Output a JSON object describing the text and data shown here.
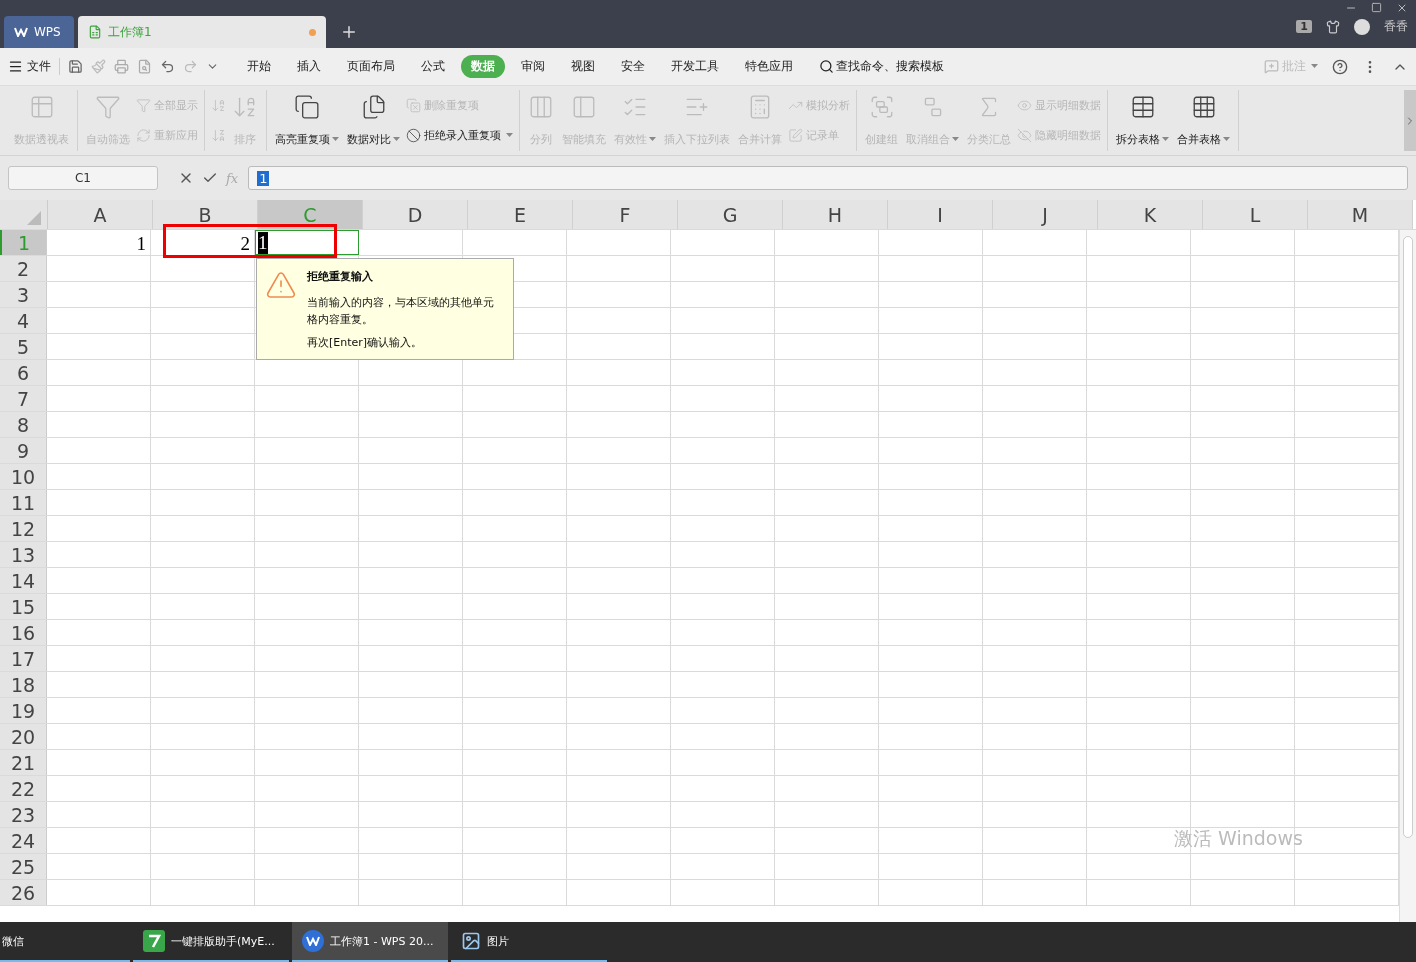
{
  "title_bar": {
    "tabs": [
      {
        "label": "WPS",
        "kind": "home",
        "selected": false
      },
      {
        "label": "工作簿1",
        "kind": "sheet",
        "selected": true,
        "unsaved": true
      }
    ],
    "badge": "1",
    "user": "香香"
  },
  "menu": {
    "file": "文件",
    "tabs": [
      {
        "label": "开始",
        "selected": false
      },
      {
        "label": "插入",
        "selected": false
      },
      {
        "label": "页面布局",
        "selected": false
      },
      {
        "label": "公式",
        "selected": false
      },
      {
        "label": "数据",
        "selected": true
      },
      {
        "label": "审阅",
        "selected": false
      },
      {
        "label": "视图",
        "selected": false
      },
      {
        "label": "安全",
        "selected": false
      },
      {
        "label": "开发工具",
        "selected": false
      },
      {
        "label": "特色应用",
        "selected": false
      }
    ],
    "search": "查找命令、搜索模板",
    "comment": {
      "label": "批注",
      "disabled": true
    }
  },
  "ribbon": {
    "groups": [
      {
        "items": [
          {
            "kind": "large",
            "label": "数据透视表",
            "disabled": true
          }
        ]
      },
      {
        "items": [
          {
            "kind": "large",
            "label": "自动筛选",
            "disabled": true
          },
          {
            "kind": "stack",
            "items": [
              {
                "label": "全部显示",
                "disabled": true
              },
              {
                "label": "重新应用",
                "disabled": true
              }
            ]
          }
        ]
      },
      {
        "items": [
          {
            "kind": "stack",
            "items": [
              {
                "disabled": true
              },
              {
                "disabled": true
              }
            ]
          },
          {
            "kind": "large",
            "label": "排序",
            "disabled": true
          }
        ]
      },
      {
        "items": [
          {
            "kind": "large",
            "label": "高亮重复项",
            "disabled": false,
            "dropdown": true
          },
          {
            "kind": "large",
            "label": "数据对比",
            "disabled": false,
            "dropdown": true
          },
          {
            "kind": "stack",
            "items": [
              {
                "label": "删除重复项",
                "disabled": true
              },
              {
                "label": "拒绝录入重复项",
                "disabled": false,
                "dropdown": true
              }
            ]
          }
        ]
      },
      {
        "items": [
          {
            "kind": "large",
            "label": "分列",
            "disabled": true
          },
          {
            "kind": "large",
            "label": "智能填充",
            "disabled": true
          },
          {
            "kind": "large",
            "label": "有效性",
            "disabled": true,
            "dropdown": true
          },
          {
            "kind": "large",
            "label": "插入下拉列表",
            "disabled": true
          },
          {
            "kind": "large",
            "label": "合并计算",
            "disabled": true
          },
          {
            "kind": "stack",
            "items": [
              {
                "label": "模拟分析",
                "disabled": true
              },
              {
                "label": "记录单",
                "disabled": true
              }
            ]
          }
        ]
      },
      {
        "items": [
          {
            "kind": "large",
            "label": "创建组",
            "disabled": true
          },
          {
            "kind": "large",
            "label": "取消组合",
            "disabled": true,
            "dropdown": true
          },
          {
            "kind": "large",
            "label": "分类汇总",
            "disabled": true
          },
          {
            "kind": "stack",
            "items": [
              {
                "label": "显示明细数据",
                "disabled": true
              },
              {
                "label": "隐藏明细数据",
                "disabled": true
              }
            ]
          }
        ]
      },
      {
        "items": [
          {
            "kind": "large",
            "label": "拆分表格",
            "disabled": false,
            "dropdown": true
          },
          {
            "kind": "large",
            "label": "合并表格",
            "disabled": false,
            "dropdown": true
          }
        ]
      }
    ]
  },
  "formula_bar": {
    "cell": "C1",
    "fx_label": "fx",
    "value": "1"
  },
  "sheet": {
    "columns": [
      {
        "label": "A",
        "selected": false
      },
      {
        "label": "B",
        "selected": false
      },
      {
        "label": "C",
        "selected": true
      },
      {
        "label": "D",
        "selected": false
      },
      {
        "label": "E",
        "selected": false
      },
      {
        "label": "F",
        "selected": false
      },
      {
        "label": "G",
        "selected": false
      },
      {
        "label": "H",
        "selected": false
      },
      {
        "label": "I",
        "selected": false
      },
      {
        "label": "J",
        "selected": false
      },
      {
        "label": "K",
        "selected": false
      },
      {
        "label": "L",
        "selected": false
      },
      {
        "label": "M",
        "selected": false
      }
    ],
    "rows": [
      {
        "label": "1",
        "selected": true,
        "cells": [
          {
            "value": "1",
            "editing": false
          },
          {
            "value": "2",
            "editing": false
          },
          {
            "value": "1",
            "editing": true
          }
        ]
      },
      {
        "label": "2",
        "selected": false
      },
      {
        "label": "3",
        "selected": false
      },
      {
        "label": "4",
        "selected": false
      },
      {
        "label": "5",
        "selected": false
      },
      {
        "label": "6",
        "selected": false
      },
      {
        "label": "7",
        "selected": false
      },
      {
        "label": "8",
        "selected": false
      },
      {
        "label": "9",
        "selected": false
      },
      {
        "label": "10",
        "selected": false
      },
      {
        "label": "11",
        "selected": false
      },
      {
        "label": "12",
        "selected": false
      },
      {
        "label": "13",
        "selected": false
      },
      {
        "label": "14",
        "selected": false
      },
      {
        "label": "15",
        "selected": false
      },
      {
        "label": "16",
        "selected": false
      },
      {
        "label": "17",
        "selected": false
      },
      {
        "label": "18",
        "selected": false
      },
      {
        "label": "19",
        "selected": false
      },
      {
        "label": "20",
        "selected": false
      },
      {
        "label": "21",
        "selected": false
      },
      {
        "label": "22",
        "selected": false
      },
      {
        "label": "23",
        "selected": false
      },
      {
        "label": "24",
        "selected": false
      },
      {
        "label": "25",
        "selected": false
      },
      {
        "label": "26",
        "selected": false
      }
    ]
  },
  "tooltip": {
    "title": "拒绝重复输入",
    "paragraphs": [
      "当前输入的内容，与本区域的其他单元格内容重复。",
      "再次[Enter]确认输入。"
    ]
  },
  "activation": "激活 Windows",
  "taskbar": {
    "items": [
      {
        "label": "微信",
        "kind": "plain",
        "selected": false
      },
      {
        "label": "一键排版助手(MyE...",
        "kind": "app",
        "selected": false
      },
      {
        "label": "工作簿1 - WPS 20...",
        "kind": "wps",
        "selected": true
      },
      {
        "label": "图片",
        "kind": "photos",
        "selected": false
      }
    ]
  }
}
